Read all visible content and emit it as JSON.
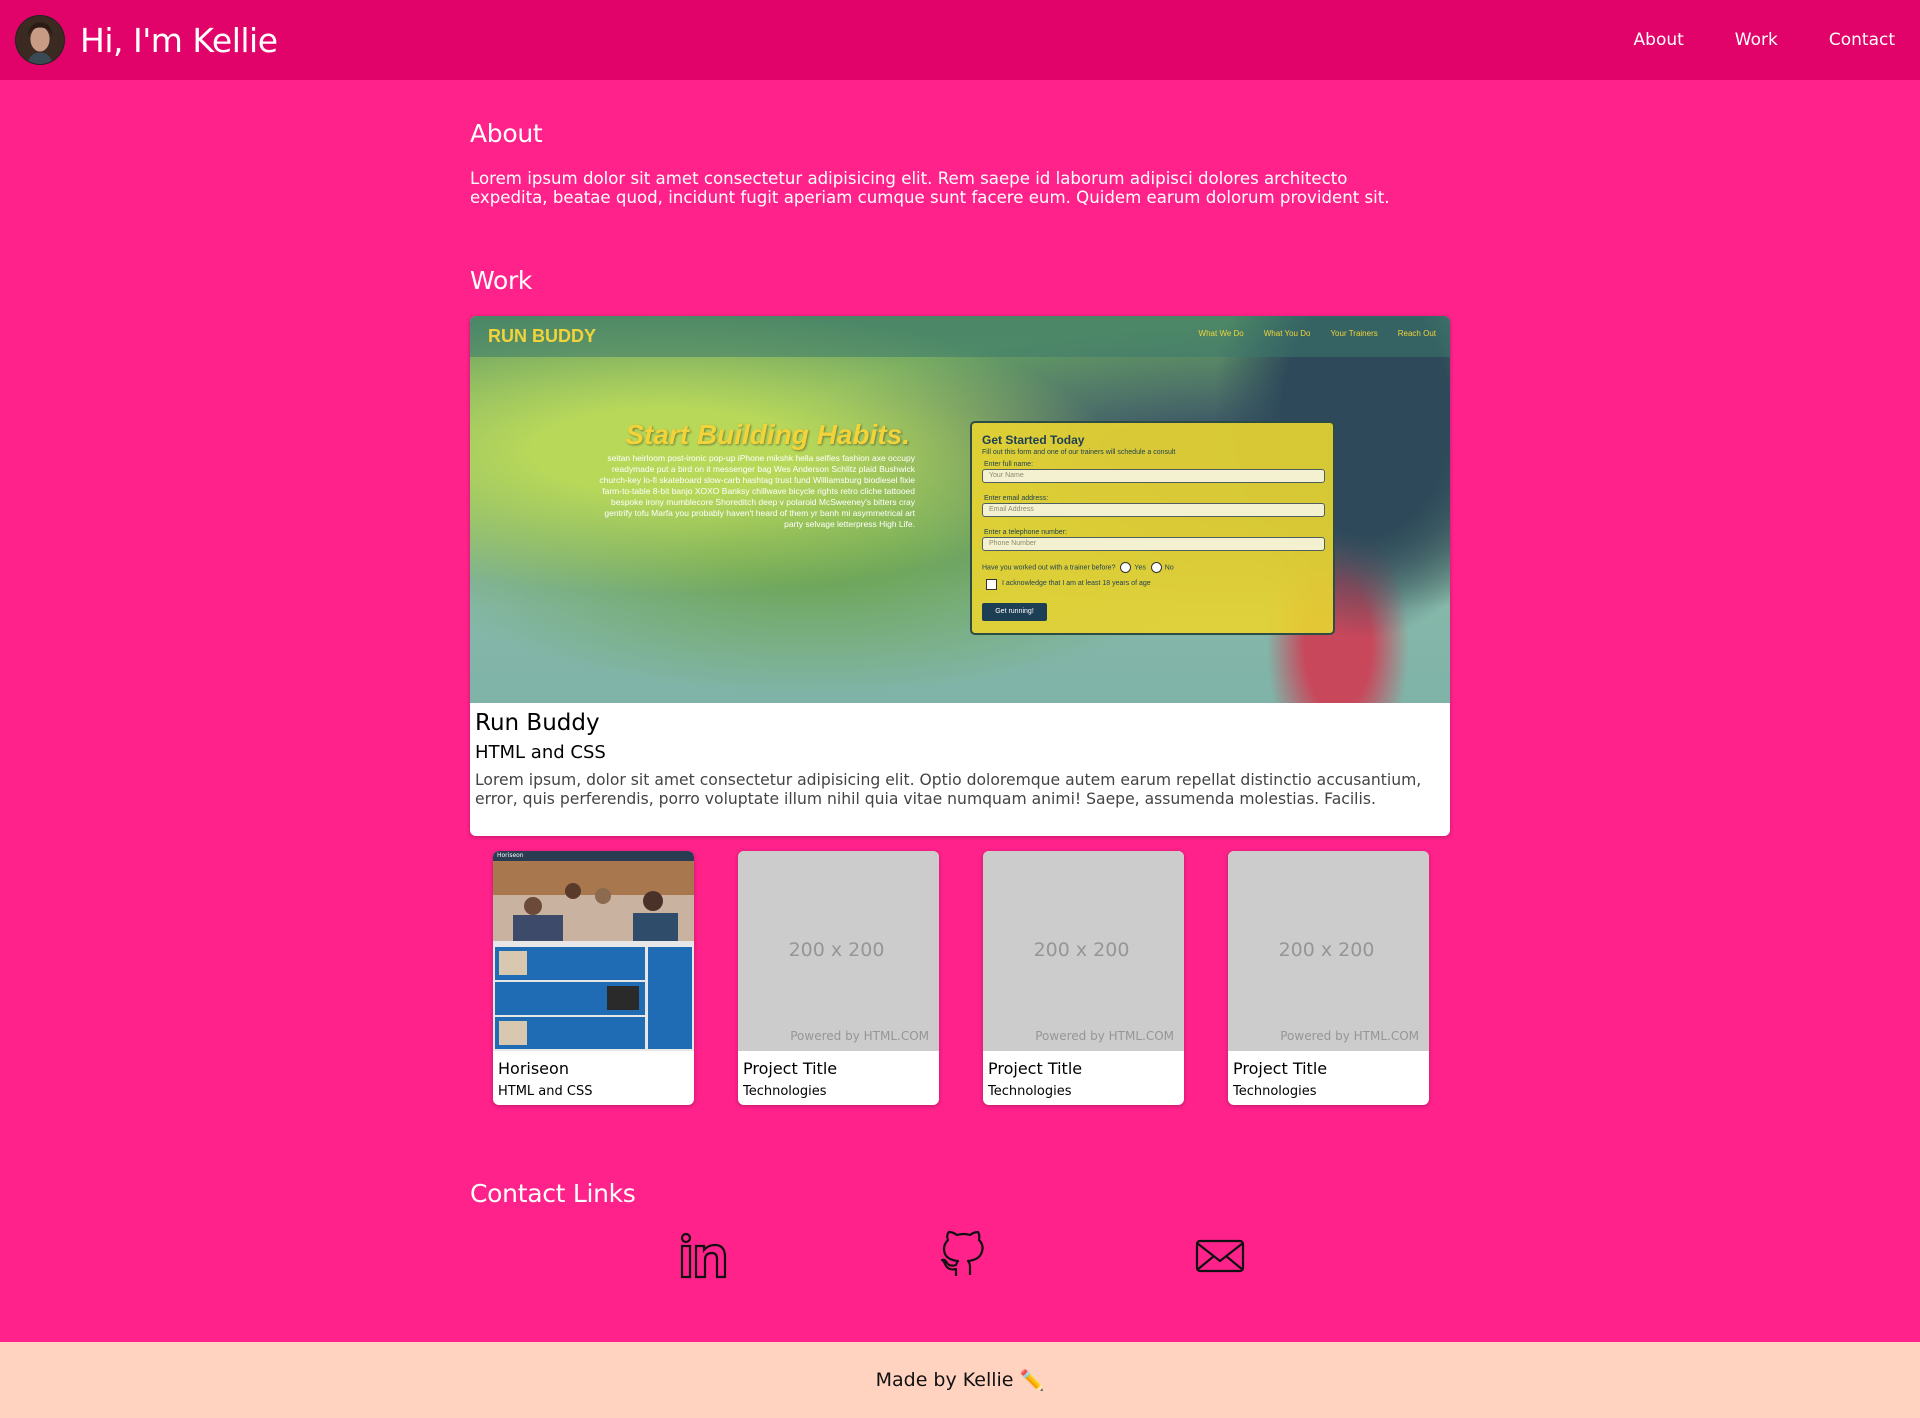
{
  "header": {
    "title": "Hi, I'm Kellie",
    "nav": [
      "About",
      "Work",
      "Contact"
    ]
  },
  "about": {
    "heading": "About",
    "text": "Lorem ipsum dolor sit amet consectetur adipisicing elit. Rem saepe id laborum adipisci dolores architecto expedita, beatae quod, incidunt fugit aperiam cumque sunt facere eum. Quidem earum dolorum provident sit."
  },
  "work": {
    "heading": "Work",
    "featured": {
      "title": "Run Buddy",
      "tech": "HTML and CSS",
      "description": "Lorem ipsum, dolor sit amet consectetur adipisicing elit. Optio doloremque autem earum repellat distinctio accusantium, error, quis perferendis, porro voluptate illum nihil quia vitae numquam animi! Saepe, assumenda molestias. Facilis.",
      "screenshot": {
        "logo": "RUN BUDDY",
        "nav": [
          "What We Do",
          "What You Do",
          "Your Trainers",
          "Reach Out"
        ],
        "headline": "Start Building Habits.",
        "paragraph": "seitan heirloom post-ironic pop-up iPhone mikshk hella selfies fashion axe occupy readymade put a bird on it messenger bag Wes Anderson Schlitz plaid Bushwick church-key lo-fi skateboard slow-carb hashtag trust fund Williamsburg biodiesel fixie farm-to-table 8-bit banjo XOXO Banksy chillwave bicycle rights retro cliche tattooed bespoke irony mumblecore Shoreditch deep v polaroid McSweeney's bitters cray gentrify tofu Marfa you probably haven't heard of them yr banh mi asymmetrical art party selvage letterpress High Life.",
        "form": {
          "title": "Get Started Today",
          "subtitle": "Fill out this form and one of our trainers will schedule a consult",
          "label_name": "Enter full name:",
          "ph_name": "Your Name",
          "label_email": "Enter email address:",
          "ph_email": "Email Address",
          "label_phone": "Enter a telephone number:",
          "ph_phone": "Phone Number",
          "question": "Have you worked out with a trainer before?",
          "yes": "Yes",
          "no": "No",
          "ack": "I acknowledge that I am at least 18 years of age",
          "button": "Get running!"
        }
      }
    },
    "projects": [
      {
        "title": "Horiseon",
        "tech": "HTML and CSS",
        "image": "screenshot",
        "logo": "Horiseon"
      },
      {
        "title": "Project Title",
        "tech": "Technologies",
        "image": "placeholder",
        "ph_size": "200 x 200",
        "ph_powered": "Powered by HTML.COM"
      },
      {
        "title": "Project Title",
        "tech": "Technologies",
        "image": "placeholder",
        "ph_size": "200 x 200",
        "ph_powered": "Powered by HTML.COM"
      },
      {
        "title": "Project Title",
        "tech": "Technologies",
        "image": "placeholder",
        "ph_size": "200 x 200",
        "ph_powered": "Powered by HTML.COM"
      }
    ]
  },
  "contact": {
    "heading": "Contact Links",
    "links": [
      {
        "icon": "linkedin-icon"
      },
      {
        "icon": "github-icon"
      },
      {
        "icon": "email-icon"
      }
    ]
  },
  "footer": {
    "text": "Made by Kellie",
    "icon": "pencil-emoji",
    "emoji": "✏️"
  },
  "colors": {
    "background": "#fe228a",
    "header": "#e10369",
    "footer": "#ffd3c0"
  }
}
